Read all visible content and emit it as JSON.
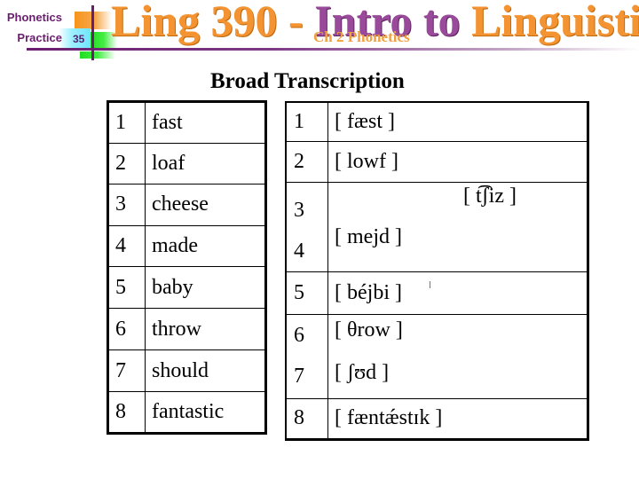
{
  "header": {
    "side_title_line1": "Phonetics",
    "side_title_line2": "Practice",
    "slide_number": "35",
    "title_part1": "Ling 390 - ",
    "title_part2": "Intro to ",
    "title_part3": "Linguistics",
    "subtitle": "Ch 2 Phonetics",
    "colors": {
      "orange": "#f39331",
      "purple": "#9a4a9a",
      "dark_purple": "#6a1f6e"
    }
  },
  "section_title": "Broad Transcription",
  "words": [
    {
      "num": "1",
      "word": "fast"
    },
    {
      "num": "2",
      "word": "loaf"
    },
    {
      "num": "3",
      "word": "cheese"
    },
    {
      "num": "4",
      "word": "made"
    },
    {
      "num": "5",
      "word": "baby"
    },
    {
      "num": "6",
      "word": "throw"
    },
    {
      "num": "7",
      "word": "should"
    },
    {
      "num": "8",
      "word": "fantastic"
    }
  ],
  "transcriptions": [
    {
      "num": "1",
      "ipa": "[ fæst ]"
    },
    {
      "num": "2",
      "ipa": "[  lowf  ]"
    },
    {
      "num": "3",
      "ipa": "[ t͡ʃiz   ]"
    },
    {
      "num": "4",
      "ipa": "[  mejd ]"
    },
    {
      "num": "5",
      "ipa": "[  béjbi ]"
    },
    {
      "num": "6",
      "ipa": "[  θrow ]"
    },
    {
      "num": "7",
      "ipa": "[  ʃʊd  ]"
    },
    {
      "num": "8",
      "ipa": "[  fæntǽstɪk ]"
    }
  ]
}
